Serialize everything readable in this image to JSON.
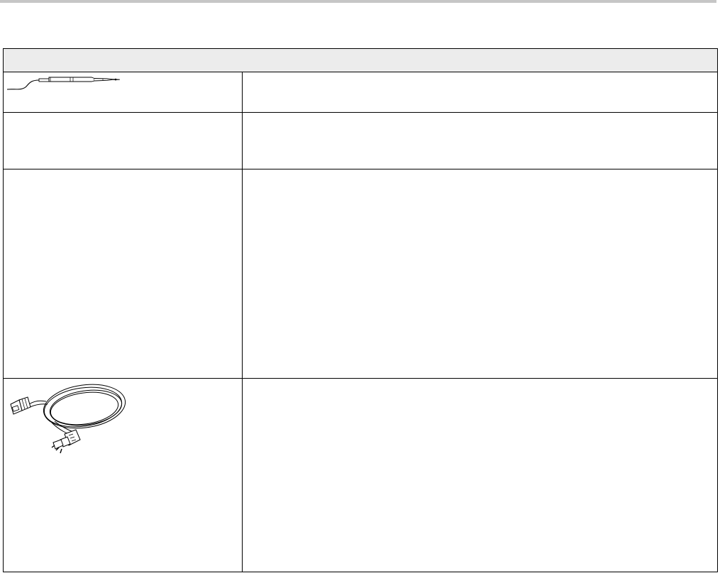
{
  "table": {
    "header": "",
    "rows": [
      {
        "item": "",
        "description": "",
        "image": "probe-illustration"
      },
      {
        "item": "",
        "description": ""
      },
      {
        "item": "",
        "description": ""
      },
      {
        "item": "",
        "description": "",
        "image": "power-cord-illustration"
      }
    ]
  }
}
